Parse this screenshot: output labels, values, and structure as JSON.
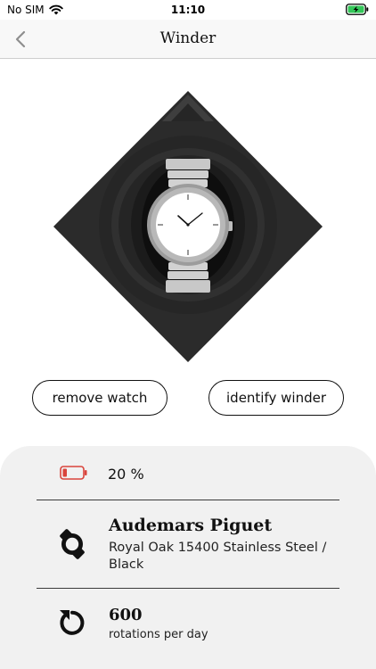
{
  "status_bar": {
    "carrier": "No SIM",
    "time": "11:10",
    "battery_state": "charging"
  },
  "nav": {
    "title": "Winder",
    "back_icon": "chevron-left-icon"
  },
  "actions": {
    "remove_label": "remove watch",
    "identify_label": "identify winder"
  },
  "info": {
    "battery": {
      "percent_text": "20 %",
      "level": 0.2,
      "color": "#d9443c"
    },
    "watch": {
      "brand": "Audemars Piguet",
      "model": "Royal Oak 15400 Stainless Steel / Black"
    },
    "rotations": {
      "count": "600",
      "unit": "rotations per day"
    }
  }
}
